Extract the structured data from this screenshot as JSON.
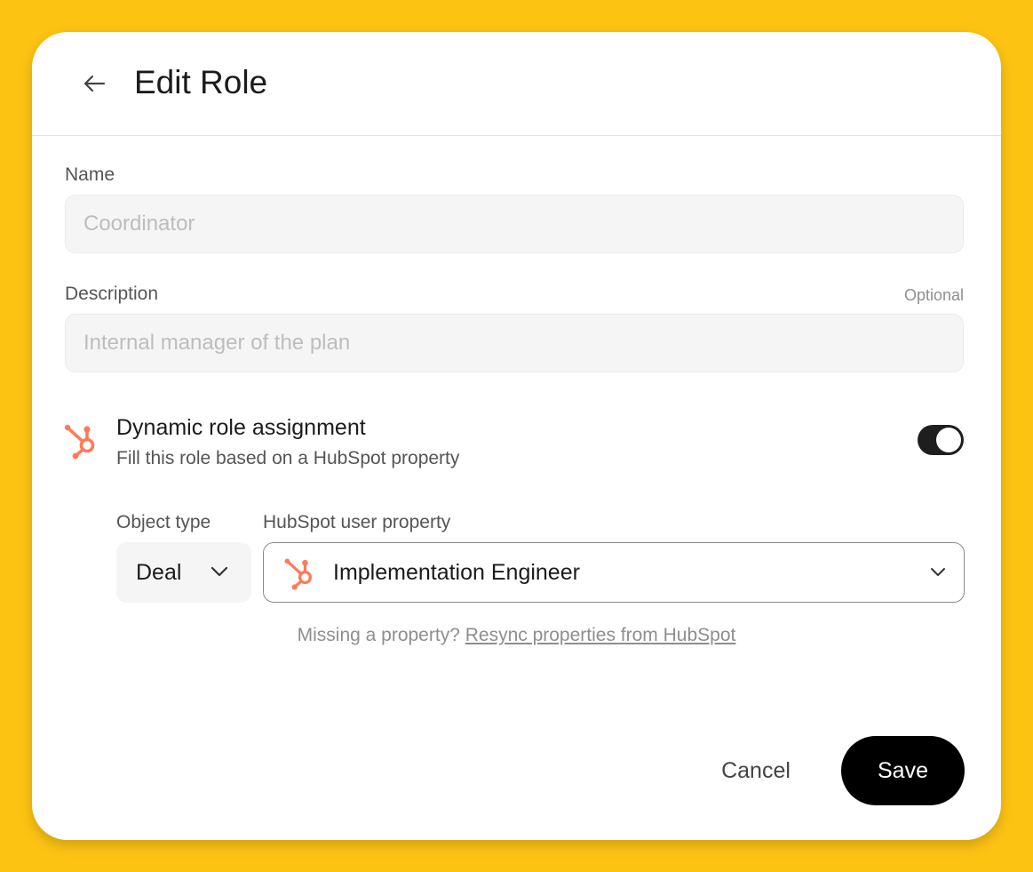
{
  "page": {
    "background_color": "#FDC313",
    "title": "Edit Role",
    "back_icon": "arrow-left-icon"
  },
  "form": {
    "name": {
      "label": "Name",
      "placeholder": "Coordinator",
      "value": ""
    },
    "description": {
      "label": "Description",
      "optional_label": "Optional",
      "placeholder": "Internal manager of the plan",
      "value": ""
    },
    "dynamic_assignment": {
      "icon": "hubspot-icon",
      "icon_color": "#FF7A59",
      "title": "Dynamic role assignment",
      "subtitle": "Fill this role based on a HubSpot property",
      "enabled": true,
      "object_type": {
        "label": "Object type",
        "selected": "Deal"
      },
      "user_property": {
        "label": "HubSpot user property",
        "selected": "Implementation Engineer"
      },
      "hint": {
        "text": "Missing a property?",
        "link": "Resync properties from HubSpot"
      }
    }
  },
  "actions": {
    "cancel_label": "Cancel",
    "save_label": "Save"
  }
}
